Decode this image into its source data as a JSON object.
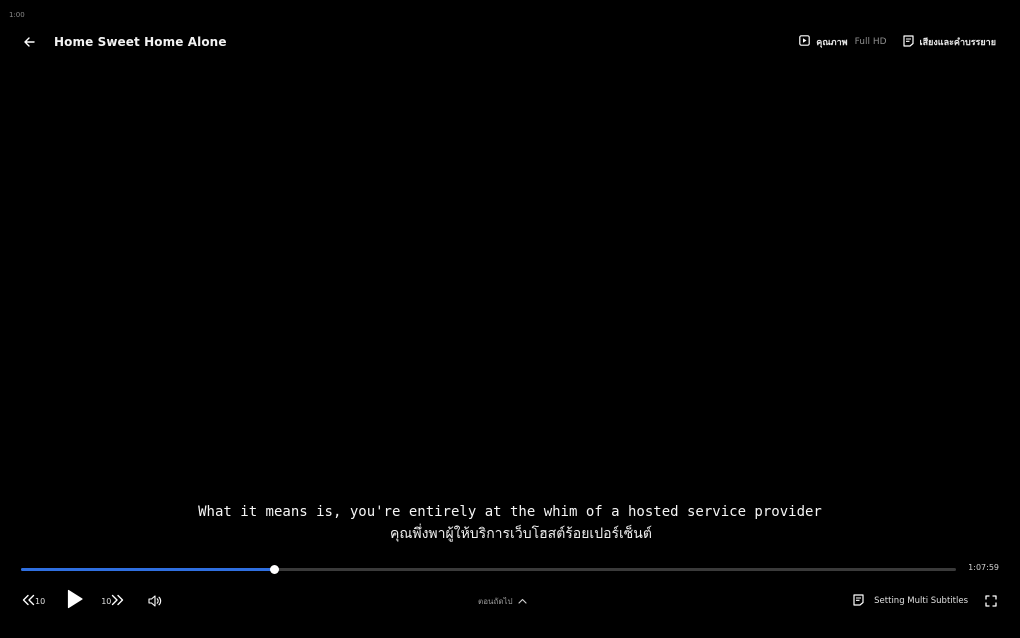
{
  "status": {
    "corner_time": "1:00"
  },
  "header": {
    "title": "Home Sweet Home Alone",
    "quality_label": "คุณภาพ",
    "quality_value": "Full HD",
    "audio_subtitle_label": "เสียงและคำบรรยาย"
  },
  "subtitles": {
    "english": "What it means is, you're entirely at the whim of a hosted service provider",
    "thai": "คุณพึ่งพาผู้ให้บริการเว็บโฮสต์ร้อยเปอร์เซ็นต์"
  },
  "playback": {
    "progress_fraction": 0.271,
    "duration": "1:07:59"
  },
  "controls": {
    "rewind_seconds": "10",
    "forward_seconds": "10",
    "episodes_label": "ตอนถัดไป",
    "multi_subtitles_label": "Setting Multi Subtitles"
  },
  "icons": {
    "back": "arrow-left-icon",
    "quality": "quality-icon",
    "audio_subtitle": "subtitle-icon",
    "rewind": "rewind-icon",
    "play": "play-icon",
    "forward": "forward-icon",
    "volume": "volume-icon",
    "episodes_chevron": "chevron-up-icon",
    "multi_subtitles": "subtitle-icon",
    "fullscreen": "fullscreen-icon"
  },
  "colors": {
    "background": "#000000",
    "progress_fill": "#2f6fe0",
    "progress_track": "#3a3a3a",
    "text_muted": "#8f8f8f"
  }
}
